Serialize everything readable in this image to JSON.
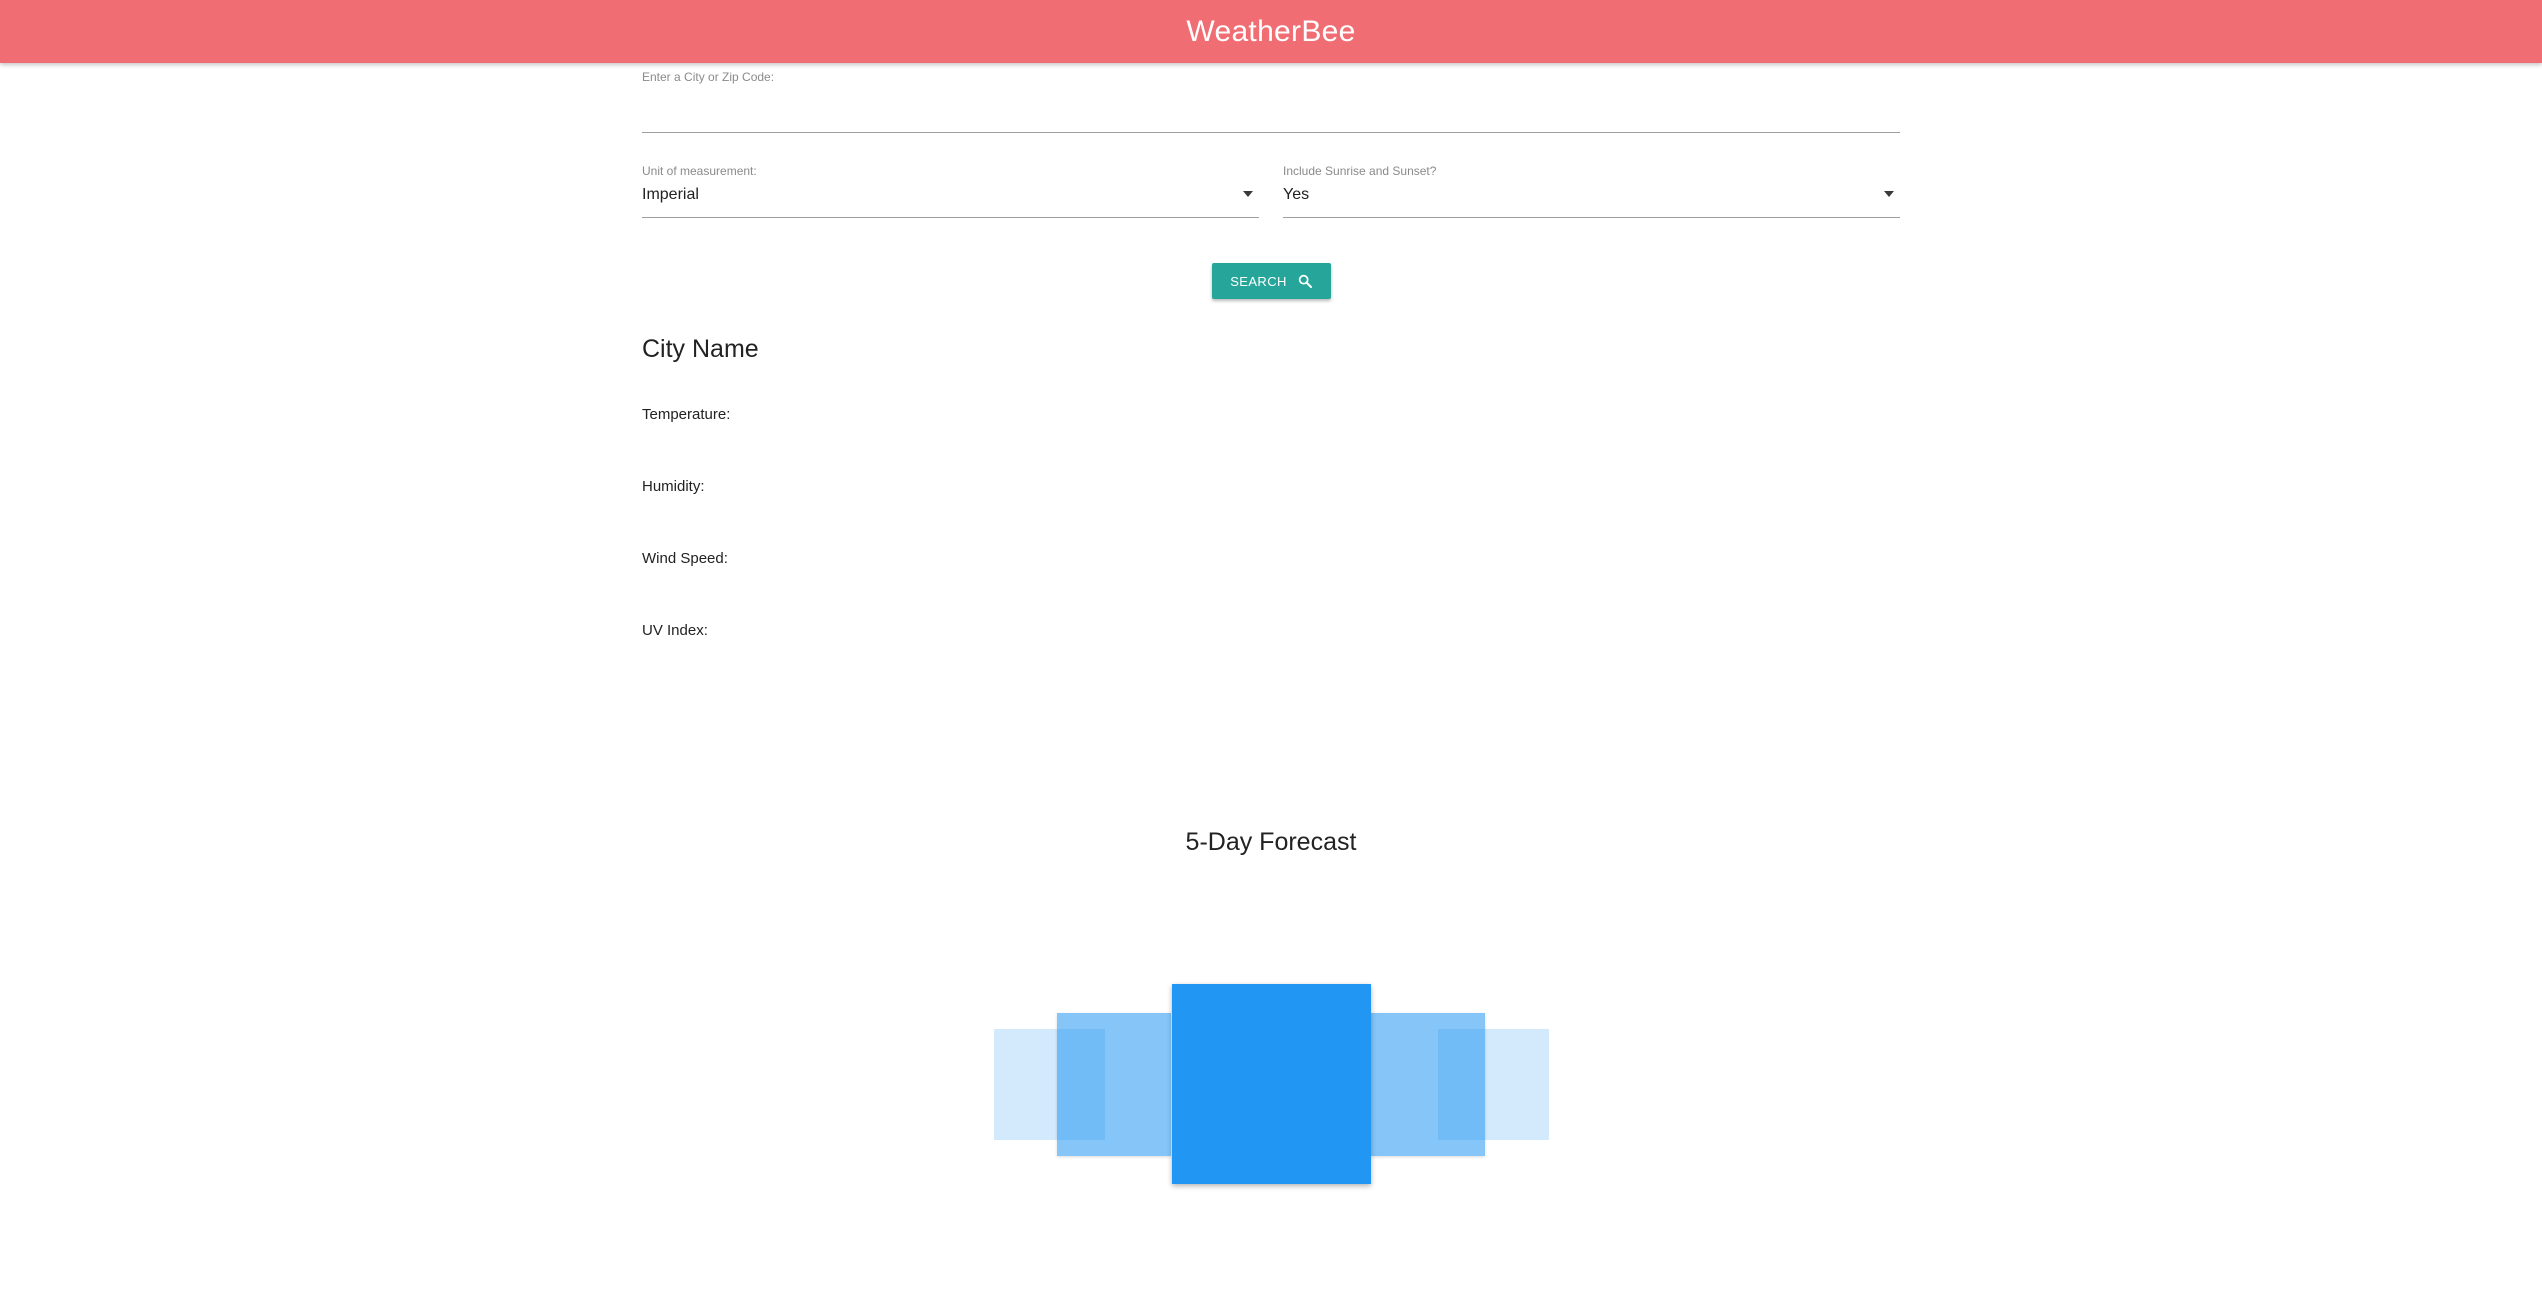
{
  "app": {
    "title": "WeatherBee"
  },
  "search": {
    "city_label": "Enter a City or Zip Code:",
    "city_value": "",
    "unit_label": "Unit of measurement:",
    "unit_value": "Imperial",
    "sun_label": "Include Sunrise and Sunset?",
    "sun_value": "Yes",
    "button_label": "SEARCH",
    "button_icon": "search-icon"
  },
  "current": {
    "city_name": "City Name",
    "temperature_label": "Temperature:",
    "humidity_label": "Humidity:",
    "wind_label": "Wind Speed:",
    "uv_label": "UV Index:"
  },
  "forecast": {
    "title": "5-Day Forecast",
    "card_count": 5
  },
  "colors": {
    "appbar": "#f06e73",
    "button": "#26a69a",
    "card": "#2196f3"
  }
}
